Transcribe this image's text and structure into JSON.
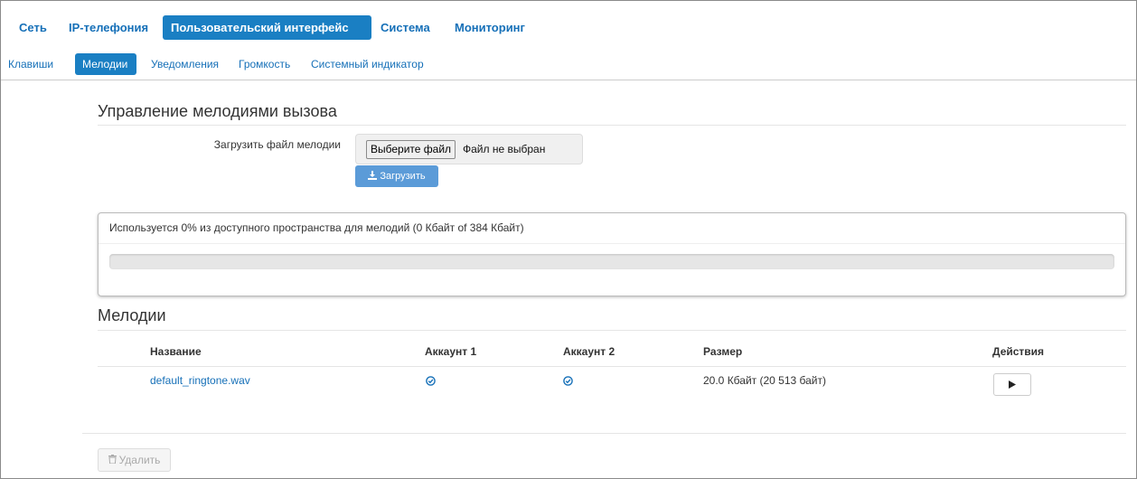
{
  "topnav": {
    "items": [
      {
        "label": "Сеть"
      },
      {
        "label": "IP-телефония"
      },
      {
        "label": "Пользовательский интерфейс",
        "active": true
      },
      {
        "label": "Система"
      },
      {
        "label": "Мониторинг"
      }
    ]
  },
  "subnav": {
    "items": [
      {
        "label": "Клавиши"
      },
      {
        "label": "Мелодии",
        "active": true
      },
      {
        "label": "Уведомления"
      },
      {
        "label": "Громкость"
      },
      {
        "label": "Системный индикатор"
      }
    ]
  },
  "ringtone_management": {
    "title": "Управление мелодиями вызова",
    "upload_label": "Загрузить файл мелодии",
    "choose_file_button": "Выберите файл",
    "file_status": "Файл не выбран",
    "upload_button": "Загрузить"
  },
  "storage": {
    "text": "Используется 0% из доступного пространства для мелодий (0 Кбайт of 384 Кбайт)",
    "used_fraction": 0
  },
  "melodies": {
    "title": "Мелодии",
    "columns": [
      "Название",
      "Аккаунт 1",
      "Аккаунт 2",
      "Размер",
      "Действия"
    ],
    "rows": [
      {
        "name": "default_ringtone.wav",
        "account1": true,
        "account2": true,
        "size": "20.0 Кбайт (20 513 байт)"
      }
    ],
    "delete_button": "Удалить"
  },
  "colors": {
    "accent": "#1a7fc3",
    "link": "#1670b8",
    "upload_button": "#5b9bd8"
  },
  "icons": {
    "upload": "download-icon",
    "check": "check-circle-icon",
    "play": "play-icon",
    "delete": "trash-icon"
  }
}
